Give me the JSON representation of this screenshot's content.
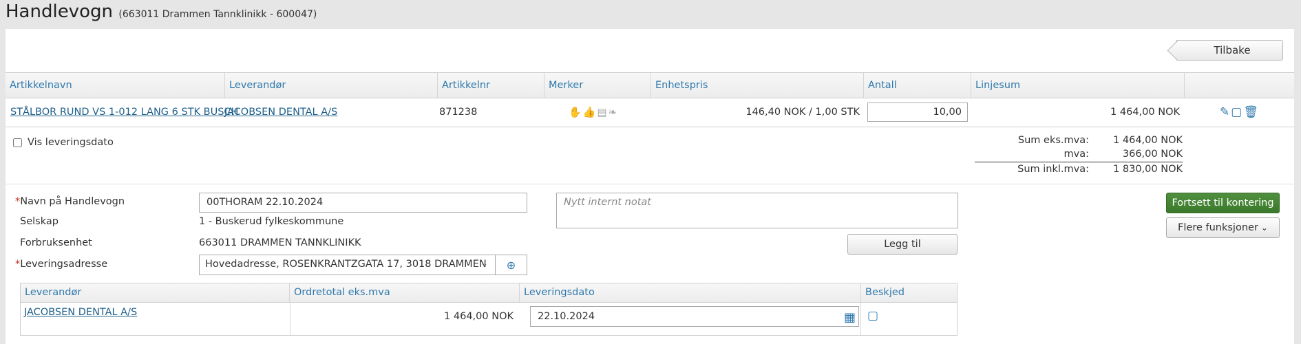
{
  "header": {
    "title": "Handlevogn",
    "subtitle": "(663011 Drammen Tannklinikk - 600047)"
  },
  "back_button": "Tilbake",
  "table": {
    "columns": [
      "Artikkelnavn",
      "Leverandør",
      "Artikkelnr",
      "Merker",
      "Enhetspris",
      "Antall",
      "Linjesum"
    ],
    "rows": [
      {
        "name": "STÅLBOR RUND VS 1-012 LANG 6 STK BUSCH",
        "supplier": "JACOBSEN DENTAL A/S",
        "article_no": "871238",
        "unit_price": "146,40 NOK / 1,00 STK",
        "quantity": "10,00",
        "line_sum": "1 464,00 NOK",
        "mark_icons": [
          "hand-icon",
          "thumbs-up-icon",
          "document-icon",
          "leaf-icon"
        ],
        "action_icons": [
          "attach-icon",
          "note-icon",
          "trash-icon"
        ]
      }
    ]
  },
  "show_delivery_date_label": "Vis leveringsdato",
  "summary": {
    "sum_ex_vat_label": "Sum eks.mva:",
    "sum_ex_vat": "1 464,00 NOK",
    "vat_label": "mva:",
    "vat": "366,00 NOK",
    "sum_inc_vat_label": "Sum inkl.mva:",
    "sum_inc_vat": "1 830,00 NOK"
  },
  "form": {
    "name_label": "Navn på Handlevogn",
    "name_value": "00THORAM 22.10.2024",
    "company_label": "Selskap",
    "company_value": "1 - Buskerud fylkeskommune",
    "unit_label": "Forbruksenhet",
    "unit_value": "663011 DRAMMEN TANNKLINIKK",
    "address_label": "Leveringsadresse",
    "address_value": "Hovedadresse, ROSENKRANTZGATA 17, 3018 DRAMMEN",
    "note_placeholder": "Nytt internt notat",
    "add_button": "Legg til"
  },
  "actions": {
    "continue": "Fortsett til kontering",
    "more": "Flere funksjoner"
  },
  "supplier_table": {
    "columns": [
      "Leverandør",
      "Ordretotal eks.mva",
      "Leveringsdato",
      "Beskjed"
    ],
    "row": {
      "supplier": "JACOBSEN DENTAL A/S",
      "total": "1 464,00 NOK",
      "date": "22.10.2024"
    }
  },
  "colors": {
    "accent": "#2f79ad",
    "link": "#1d5f8a",
    "primary_button": "#3f7f31",
    "required": "#c0392b"
  }
}
